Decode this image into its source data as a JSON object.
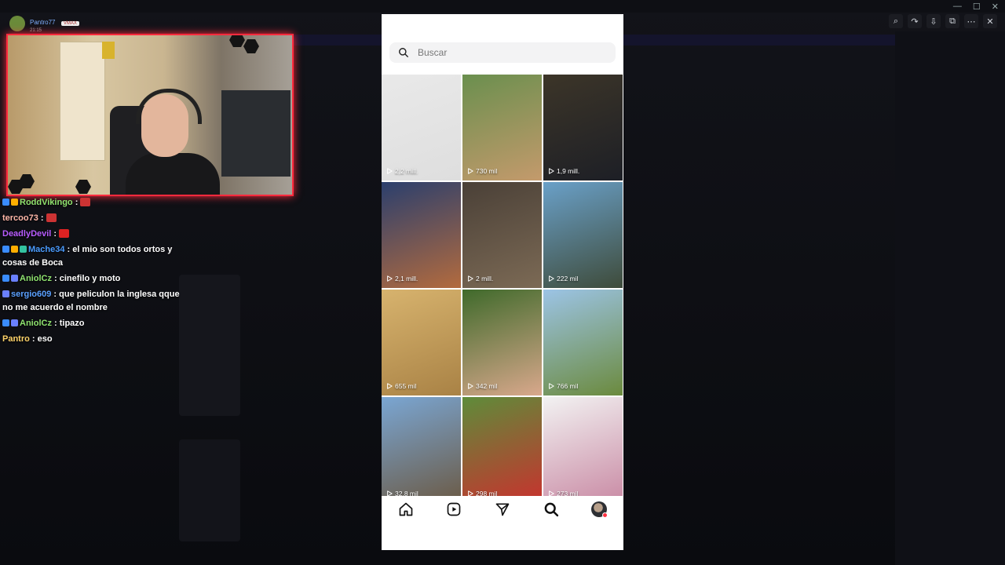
{
  "streamer": {
    "name": "Pantro77",
    "badge": "VMAX",
    "subline": "21:15"
  },
  "chat": [
    {
      "user": "RoddVikingo",
      "color": "#8fe36f",
      "message": "",
      "badges": [
        "#3a8cff",
        "#ffae00"
      ],
      "emote": "#c33"
    },
    {
      "user": "tercoo73",
      "color": "#ffb7a8",
      "message": "",
      "badges": [],
      "emote": "#c33"
    },
    {
      "user": "DeadlyDevil",
      "color": "#b85cff",
      "message": "",
      "badges": [],
      "emote": "#d22"
    },
    {
      "user": "Mache34",
      "color": "#4a9cff",
      "message": "el mio son todos ortos y cosas de Boca",
      "badges": [
        "#3a8cff",
        "#ffae00",
        "#33c3a0"
      ],
      "emote": null
    },
    {
      "user": "AniolCz",
      "color": "#8fe36f",
      "message": "cinefilo y moto",
      "badges": [
        "#3a8cff",
        "#6a80ff"
      ],
      "emote": null
    },
    {
      "user": "sergio609",
      "color": "#5aa0ff",
      "message": "que peliculon la inglesa qque no me acuerdo el nombre",
      "badges": [
        "#6a80ff"
      ],
      "emote": null
    },
    {
      "user": "AniolCz",
      "color": "#8fe36f",
      "message": "tipazo",
      "badges": [
        "#3a8cff",
        "#6a80ff"
      ],
      "emote": null
    },
    {
      "user": "Pantro",
      "color": "#ffd36a",
      "message": "eso",
      "badges": [],
      "emote": null
    }
  ],
  "search": {
    "placeholder": "Buscar"
  },
  "grid": [
    {
      "views": "2,2 mill.",
      "colors": [
        "#e9e9e9",
        "#dedede"
      ]
    },
    {
      "views": "730 mil",
      "colors": [
        "#6a8f4e",
        "#c49a6c"
      ]
    },
    {
      "views": "1,9 mill.",
      "colors": [
        "#3c3528",
        "#1d1f26"
      ]
    },
    {
      "views": "2,1 mill.",
      "colors": [
        "#2b3f6d",
        "#b36b3e"
      ]
    },
    {
      "views": "2 mill.",
      "colors": [
        "#4a4037",
        "#7c6a55"
      ]
    },
    {
      "views": "222 mil",
      "colors": [
        "#6aa0c8",
        "#3e4b3a"
      ]
    },
    {
      "views": "655 mil",
      "colors": [
        "#d7b36e",
        "#a98245"
      ]
    },
    {
      "views": "342 mil",
      "colors": [
        "#3f6a2b",
        "#d9a88c"
      ]
    },
    {
      "views": "766 mil",
      "colors": [
        "#9cc4e6",
        "#6b8a3d"
      ]
    },
    {
      "views": "32,8 mil",
      "colors": [
        "#7aa6d3",
        "#6b5a45"
      ]
    },
    {
      "views": "298 mil",
      "colors": [
        "#5e8c3a",
        "#c8322e"
      ]
    },
    {
      "views": "273 mil",
      "colors": [
        "#f2f2f2",
        "#c98aa4"
      ]
    }
  ],
  "nav": {
    "items": [
      "home-icon",
      "reels-icon",
      "direct-icon",
      "search-icon",
      "profile-avatar"
    ]
  }
}
